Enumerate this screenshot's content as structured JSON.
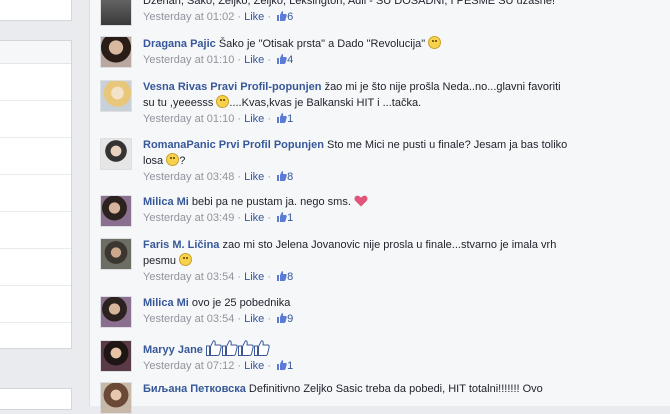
{
  "comments": [
    {
      "author": "",
      "text": "Dzenan, Sako, Zeljko, Zeljko, Leksington, Adil - SU DOSADNI, I PESME SU uzasne!",
      "time": "Yesterday at 01:02",
      "like": "Like",
      "likes": "6"
    },
    {
      "author": "Dragana Pajic",
      "text": "Šako je \"Otisak prsta\" a Dado \"Revolucija\"",
      "time": "Yesterday at 01:10",
      "like": "Like",
      "likes": "4"
    },
    {
      "author": "Vesna Rivas Pravi Profil-popunjen",
      "text": "žao mi je što nije prošla Neda..no...glavni favoriti su tu ,yeeesss",
      "text2": "....Kvas,kvas je Balkanski HIT i ...tačka.",
      "time": "Yesterday at 01:10",
      "like": "Like",
      "likes": "1"
    },
    {
      "author": "RomanaPanic Prvi Profil Popunjen",
      "text": "Sto me Mici ne pusti u finale? Jesam ja bas toliko losa",
      "text2": "?",
      "time": "Yesterday at 03:48",
      "like": "Like",
      "likes": "8"
    },
    {
      "author": "Milica Mi",
      "text": "bebi pa ne pustam ja. nego sms.",
      "time": "Yesterday at 03:49",
      "like": "Like",
      "likes": "1"
    },
    {
      "author": "Faris M. Ličina",
      "text": "zao mi sto Jelena Jovanovic nije prosla u finale...stvarno je imala vrh pesmu",
      "time": "Yesterday at 03:54",
      "like": "Like",
      "likes": "8"
    },
    {
      "author": "Milica Mi",
      "text": "ovo je 25 pobednika",
      "time": "Yesterday at 03:54",
      "like": "Like",
      "likes": "9"
    },
    {
      "author": "Maryy Jane",
      "text": "",
      "time": "Yesterday at 07:12",
      "like": "Like",
      "likes": "1"
    },
    {
      "author": "Биљана Петковска",
      "text": "Definitivno Zeljko Sasic treba da pobedi, HIT totalni!!!!!!! Ovo",
      "time": "",
      "like": "",
      "likes": ""
    }
  ],
  "icons": {
    "like_thumb": "thumbs-up-icon",
    "smiley": "smiley-emoticon-icon",
    "heart": "heart-emoticon-icon"
  },
  "colors": {
    "author": "#365899",
    "meta": "#90949c",
    "text": "#1d2129",
    "feed_bg": "#f6f7f9",
    "page_bg": "#e9ebee"
  }
}
